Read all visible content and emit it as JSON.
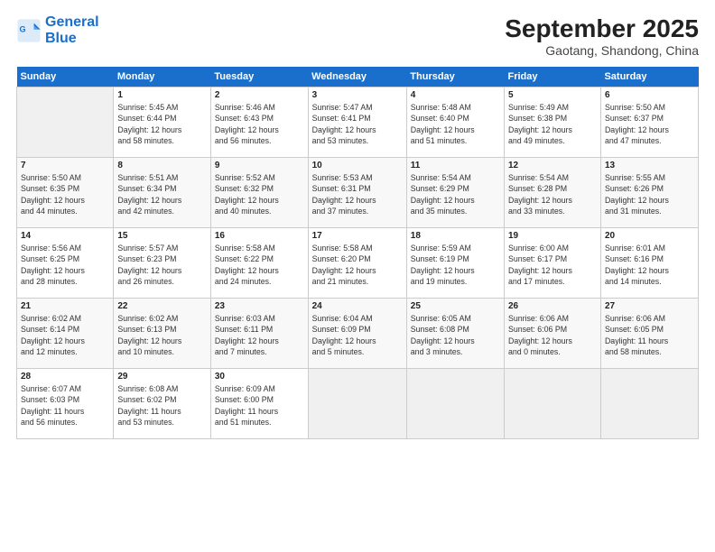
{
  "logo": {
    "line1": "General",
    "line2": "Blue"
  },
  "title": "September 2025",
  "subtitle": "Gaotang, Shandong, China",
  "headers": [
    "Sunday",
    "Monday",
    "Tuesday",
    "Wednesday",
    "Thursday",
    "Friday",
    "Saturday"
  ],
  "weeks": [
    [
      {
        "num": "",
        "info": ""
      },
      {
        "num": "1",
        "info": "Sunrise: 5:45 AM\nSunset: 6:44 PM\nDaylight: 12 hours\nand 58 minutes."
      },
      {
        "num": "2",
        "info": "Sunrise: 5:46 AM\nSunset: 6:43 PM\nDaylight: 12 hours\nand 56 minutes."
      },
      {
        "num": "3",
        "info": "Sunrise: 5:47 AM\nSunset: 6:41 PM\nDaylight: 12 hours\nand 53 minutes."
      },
      {
        "num": "4",
        "info": "Sunrise: 5:48 AM\nSunset: 6:40 PM\nDaylight: 12 hours\nand 51 minutes."
      },
      {
        "num": "5",
        "info": "Sunrise: 5:49 AM\nSunset: 6:38 PM\nDaylight: 12 hours\nand 49 minutes."
      },
      {
        "num": "6",
        "info": "Sunrise: 5:50 AM\nSunset: 6:37 PM\nDaylight: 12 hours\nand 47 minutes."
      }
    ],
    [
      {
        "num": "7",
        "info": "Sunrise: 5:50 AM\nSunset: 6:35 PM\nDaylight: 12 hours\nand 44 minutes."
      },
      {
        "num": "8",
        "info": "Sunrise: 5:51 AM\nSunset: 6:34 PM\nDaylight: 12 hours\nand 42 minutes."
      },
      {
        "num": "9",
        "info": "Sunrise: 5:52 AM\nSunset: 6:32 PM\nDaylight: 12 hours\nand 40 minutes."
      },
      {
        "num": "10",
        "info": "Sunrise: 5:53 AM\nSunset: 6:31 PM\nDaylight: 12 hours\nand 37 minutes."
      },
      {
        "num": "11",
        "info": "Sunrise: 5:54 AM\nSunset: 6:29 PM\nDaylight: 12 hours\nand 35 minutes."
      },
      {
        "num": "12",
        "info": "Sunrise: 5:54 AM\nSunset: 6:28 PM\nDaylight: 12 hours\nand 33 minutes."
      },
      {
        "num": "13",
        "info": "Sunrise: 5:55 AM\nSunset: 6:26 PM\nDaylight: 12 hours\nand 31 minutes."
      }
    ],
    [
      {
        "num": "14",
        "info": "Sunrise: 5:56 AM\nSunset: 6:25 PM\nDaylight: 12 hours\nand 28 minutes."
      },
      {
        "num": "15",
        "info": "Sunrise: 5:57 AM\nSunset: 6:23 PM\nDaylight: 12 hours\nand 26 minutes."
      },
      {
        "num": "16",
        "info": "Sunrise: 5:58 AM\nSunset: 6:22 PM\nDaylight: 12 hours\nand 24 minutes."
      },
      {
        "num": "17",
        "info": "Sunrise: 5:58 AM\nSunset: 6:20 PM\nDaylight: 12 hours\nand 21 minutes."
      },
      {
        "num": "18",
        "info": "Sunrise: 5:59 AM\nSunset: 6:19 PM\nDaylight: 12 hours\nand 19 minutes."
      },
      {
        "num": "19",
        "info": "Sunrise: 6:00 AM\nSunset: 6:17 PM\nDaylight: 12 hours\nand 17 minutes."
      },
      {
        "num": "20",
        "info": "Sunrise: 6:01 AM\nSunset: 6:16 PM\nDaylight: 12 hours\nand 14 minutes."
      }
    ],
    [
      {
        "num": "21",
        "info": "Sunrise: 6:02 AM\nSunset: 6:14 PM\nDaylight: 12 hours\nand 12 minutes."
      },
      {
        "num": "22",
        "info": "Sunrise: 6:02 AM\nSunset: 6:13 PM\nDaylight: 12 hours\nand 10 minutes."
      },
      {
        "num": "23",
        "info": "Sunrise: 6:03 AM\nSunset: 6:11 PM\nDaylight: 12 hours\nand 7 minutes."
      },
      {
        "num": "24",
        "info": "Sunrise: 6:04 AM\nSunset: 6:09 PM\nDaylight: 12 hours\nand 5 minutes."
      },
      {
        "num": "25",
        "info": "Sunrise: 6:05 AM\nSunset: 6:08 PM\nDaylight: 12 hours\nand 3 minutes."
      },
      {
        "num": "26",
        "info": "Sunrise: 6:06 AM\nSunset: 6:06 PM\nDaylight: 12 hours\nand 0 minutes."
      },
      {
        "num": "27",
        "info": "Sunrise: 6:06 AM\nSunset: 6:05 PM\nDaylight: 11 hours\nand 58 minutes."
      }
    ],
    [
      {
        "num": "28",
        "info": "Sunrise: 6:07 AM\nSunset: 6:03 PM\nDaylight: 11 hours\nand 56 minutes."
      },
      {
        "num": "29",
        "info": "Sunrise: 6:08 AM\nSunset: 6:02 PM\nDaylight: 11 hours\nand 53 minutes."
      },
      {
        "num": "30",
        "info": "Sunrise: 6:09 AM\nSunset: 6:00 PM\nDaylight: 11 hours\nand 51 minutes."
      },
      {
        "num": "",
        "info": ""
      },
      {
        "num": "",
        "info": ""
      },
      {
        "num": "",
        "info": ""
      },
      {
        "num": "",
        "info": ""
      }
    ]
  ]
}
